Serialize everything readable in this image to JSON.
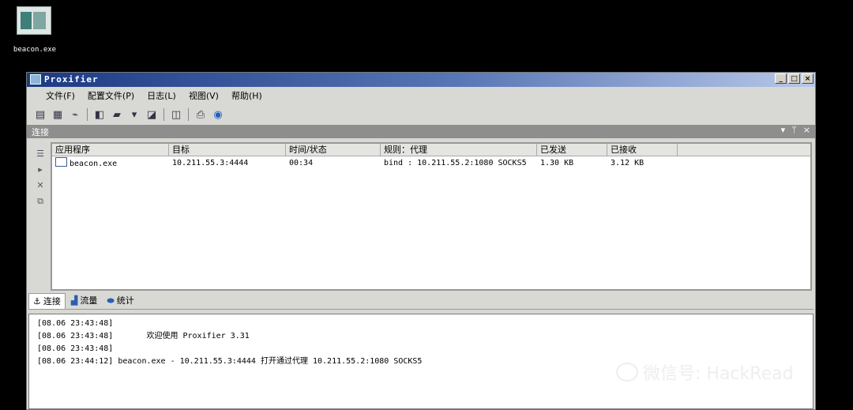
{
  "desktop": {
    "icon_label": "beacon.exe"
  },
  "window": {
    "title": "Proxifier",
    "controls": {
      "minimize": "_",
      "maximize": "□",
      "close": "×"
    }
  },
  "menu": [
    "文件(F)",
    "配置文件(P)",
    "日志(L)",
    "视图(V)",
    "帮助(H)"
  ],
  "panel": {
    "title": "连接",
    "controls": {
      "dropdown": "▾",
      "pin": "ᛘ",
      "close": "×"
    }
  },
  "columns": [
    "应用程序",
    "目标",
    "时间/状态",
    "规则：代理",
    "已发送",
    "已接收"
  ],
  "rows": [
    {
      "app": "beacon.exe",
      "target": "10.211.55.3:4444",
      "time": "00:34",
      "rule": "bind : 10.211.55.2:1080 SOCKS5",
      "sent": "1.30 KB",
      "received": "3.12 KB"
    }
  ],
  "tabs": [
    "连接",
    "流量",
    "统计"
  ],
  "log": [
    "[08.06 23:43:48]",
    "[08.06 23:43:48]       欢迎使用 Proxifier 3.31",
    "[08.06 23:43:48]",
    "[08.06 23:44:12] beacon.exe - 10.211.55.3:4444 打开通过代理 10.211.55.2:1080 SOCKS5"
  ],
  "watermark": "微信号: HackRead",
  "icons": [
    "proxifier-app-icon",
    "proxy-servers-icon",
    "rules-icon",
    "resolve-icon",
    "new-profile-icon",
    "open-profile-icon",
    "save-profile-icon",
    "options-icon",
    "print-icon",
    "help-icon"
  ]
}
